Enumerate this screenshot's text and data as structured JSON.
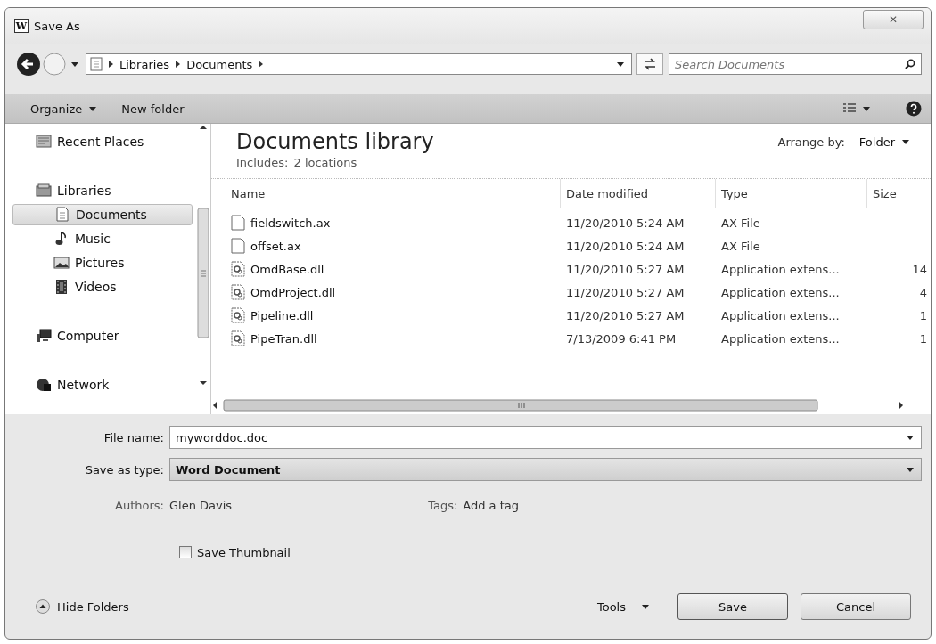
{
  "window": {
    "icon_letter": "W",
    "title": "Save As",
    "close": "✕"
  },
  "address_bar": {
    "crumbs": [
      "Libraries",
      "Documents"
    ],
    "search_placeholder": "Search Documents"
  },
  "toolbar": {
    "organize": "Organize",
    "new_folder": "New folder"
  },
  "nav": [
    {
      "label": "Recent Places",
      "kind": "recent",
      "selected": false
    },
    {
      "label": "Libraries",
      "kind": "libraries",
      "selected": false,
      "children": [
        {
          "label": "Documents",
          "kind": "documents",
          "selected": true
        },
        {
          "label": "Music",
          "kind": "music",
          "selected": false
        },
        {
          "label": "Pictures",
          "kind": "pictures",
          "selected": false
        },
        {
          "label": "Videos",
          "kind": "videos",
          "selected": false
        }
      ]
    },
    {
      "label": "Computer",
      "kind": "computer",
      "selected": false
    },
    {
      "label": "Network",
      "kind": "network",
      "selected": false
    }
  ],
  "library": {
    "title": "Documents library",
    "includes_label": "Includes:",
    "includes_link": "2 locations",
    "arrange_label": "Arrange by:",
    "arrange_value": "Folder"
  },
  "table": {
    "columns": [
      "Name",
      "Date modified",
      "Type",
      "Size"
    ],
    "rows": [
      {
        "kind": "blank",
        "name": "fieldswitch.ax",
        "date": "11/20/2010 5:24 AM",
        "type": "AX File"
      },
      {
        "kind": "blank",
        "name": "offset.ax",
        "date": "11/20/2010 5:24 AM",
        "type": "AX File"
      },
      {
        "kind": "dll",
        "name": "OmdBase.dll",
        "date": "11/20/2010 5:27 AM",
        "type": "Application extens...",
        "size": "14"
      },
      {
        "kind": "dll",
        "name": "OmdProject.dll",
        "date": "11/20/2010 5:27 AM",
        "type": "Application extens...",
        "size": "4"
      },
      {
        "kind": "dll",
        "name": "Pipeline.dll",
        "date": "11/20/2010 5:27 AM",
        "type": "Application extens...",
        "size": "1"
      },
      {
        "kind": "dll",
        "name": "PipeTran.dll",
        "date": "7/13/2009 6:41 PM",
        "type": "Application extens...",
        "size": "1"
      }
    ]
  },
  "form": {
    "file_name_label": "File name:",
    "file_name": "myworddoc.doc",
    "type_label": "Save as type:",
    "type_value": "Word Document",
    "authors_label": "Authors:",
    "authors": "Glen Davis",
    "tags_label": "Tags:",
    "tags_placeholder": "Add a tag",
    "thumbnail": {
      "label": "Save Thumbnail",
      "checked": false
    }
  },
  "footer": {
    "hide_folders": "Hide Folders",
    "tools": "Tools",
    "save": "Save",
    "cancel": "Cancel"
  }
}
